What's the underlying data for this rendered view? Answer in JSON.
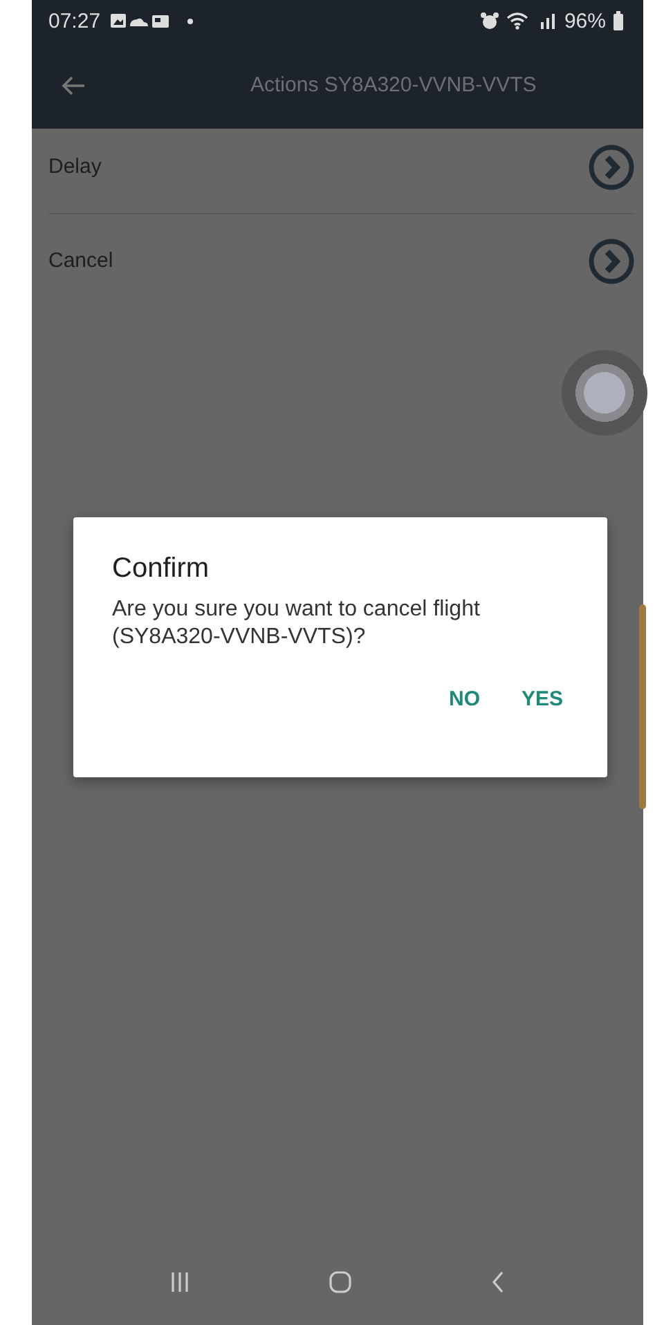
{
  "status_bar": {
    "time": "07:27",
    "battery": "96%"
  },
  "app_bar": {
    "title": "Actions SY8A320-VVNB-VVTS"
  },
  "actions": [
    {
      "label": "Delay"
    },
    {
      "label": "Cancel"
    }
  ],
  "dialog": {
    "title": "Confirm",
    "message": "Are you sure you want to cancel flight (SY8A320-VVNB-VVTS)?",
    "buttons": [
      "NO",
      "YES"
    ]
  }
}
